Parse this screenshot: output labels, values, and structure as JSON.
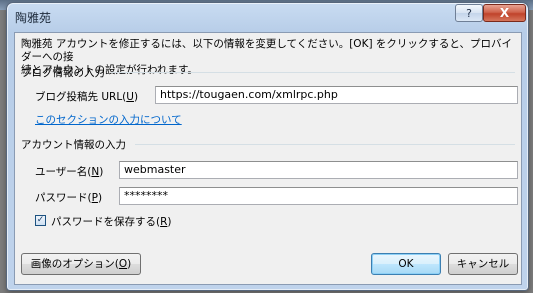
{
  "window": {
    "title": "陶雅苑",
    "help_glyph": "?",
    "close_glyph": "X"
  },
  "intro": "陶雅苑 アカウントを修正するには、以下の情報を変更してください。[OK] をクリックすると、プロバイダーへの接\n続とアカウントの設定が行われます。",
  "blog_section": {
    "title": "ブログ情報の入力",
    "url_label_prefix": "ブログ投稿先 URL(",
    "url_label_key": "U",
    "url_label_suffix": ")",
    "url_value": "https://tougaen.com/xmlrpc.php",
    "help_link": "このセクションの入力について"
  },
  "account_section": {
    "title": "アカウント情報の入力",
    "user_label_prefix": "ユーザー名(",
    "user_label_key": "N",
    "user_label_suffix": ")",
    "user_value": "webmaster",
    "password_label_prefix": "パスワード(",
    "password_label_key": "P",
    "password_label_suffix": ")",
    "password_value": "********",
    "remember_label_prefix": "パスワードを保存する(",
    "remember_label_key": "R",
    "remember_label_suffix": ")",
    "remember_checked": true,
    "check_glyph": "✓"
  },
  "buttons": {
    "image_options_prefix": "画像のオプション(",
    "image_options_key": "O",
    "image_options_suffix": ")",
    "ok": "OK",
    "cancel": "キャンセル"
  }
}
